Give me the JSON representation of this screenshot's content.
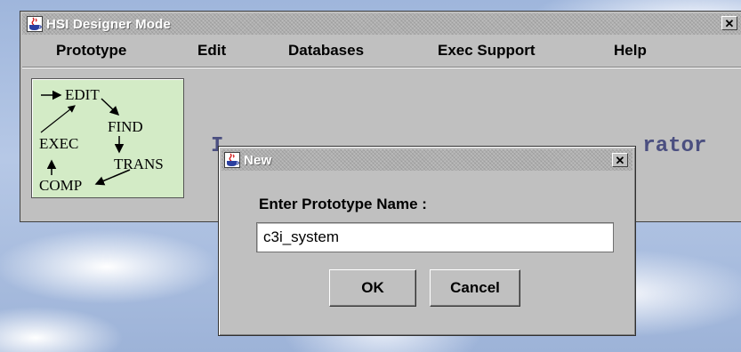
{
  "main_window": {
    "title": "HSI Designer Mode",
    "close_glyph": "✕",
    "menu": [
      "Prototype",
      "Edit",
      "Databases",
      "Exec Support",
      "Help"
    ],
    "logo": {
      "labels": [
        "EDIT",
        "FIND",
        "EXEC",
        "TRANS",
        "COMP"
      ],
      "background": "#d3ebc6"
    },
    "obscured_text_left": "I",
    "obscured_text_right": "rator"
  },
  "dialog": {
    "title": "New",
    "close_glyph": "✕",
    "prompt": "Enter Prototype Name :",
    "input_value": "c3i_system",
    "ok_label": "OK",
    "cancel_label": "Cancel"
  },
  "icons": [
    "java-app-icon",
    "close-icon",
    "workflow-logo"
  ],
  "colors": {
    "window_bg": "#c0c0c0",
    "title_text": "#ffffff",
    "admin_text": "#4b4f80",
    "input_bg": "#ffffff"
  }
}
